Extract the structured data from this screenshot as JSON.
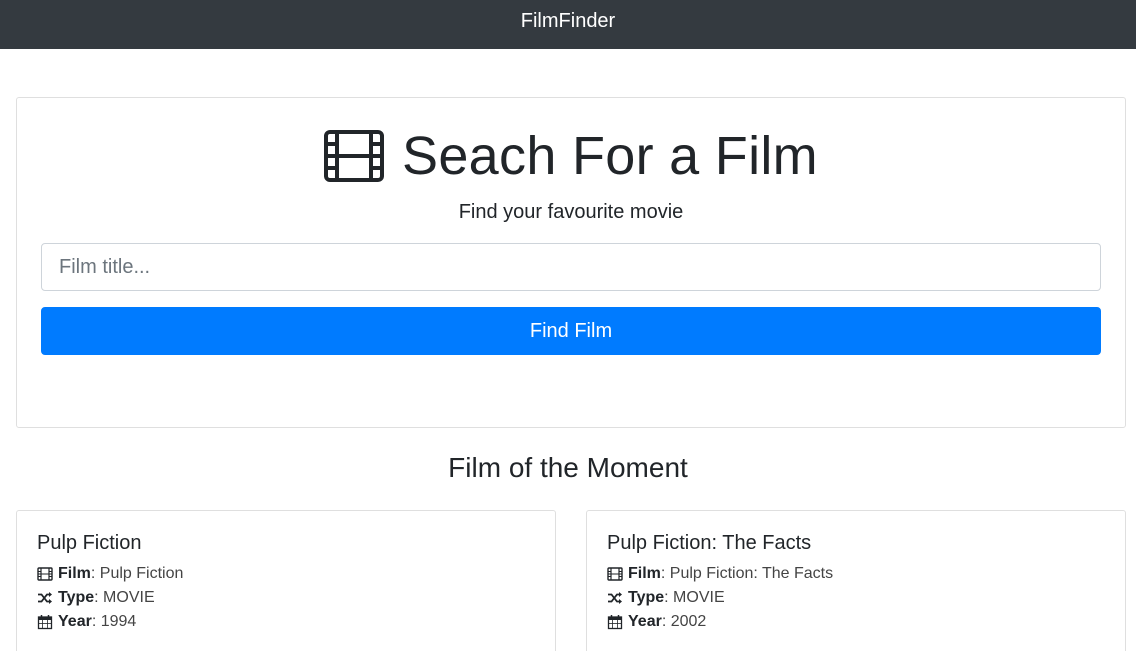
{
  "navbar": {
    "brand": "FilmFinder"
  },
  "search": {
    "title": "Seach For a Film",
    "subtitle": "Find your favourite movie",
    "placeholder": "Film title...",
    "button_label": "Find Film"
  },
  "featured": {
    "heading": "Film of the Moment",
    "cards": [
      {
        "title": "Pulp Fiction",
        "film_label": "Film",
        "film_value": ": Pulp Fiction",
        "type_label": "Type",
        "type_value": ": MOVIE",
        "year_label": "Year",
        "year_value": ": 1994"
      },
      {
        "title": "Pulp Fiction: The Facts",
        "film_label": "Film",
        "film_value": ": Pulp Fiction: The Facts",
        "type_label": "Type",
        "type_value": ": MOVIE",
        "year_label": "Year",
        "year_value": ": 2002"
      }
    ]
  },
  "colors": {
    "navbar": "#343a40",
    "primary": "#007bff",
    "text": "#212529"
  },
  "icons": {
    "title": "film-icon",
    "film": "film-icon",
    "type": "shuffle-icon",
    "year": "calendar-icon"
  }
}
